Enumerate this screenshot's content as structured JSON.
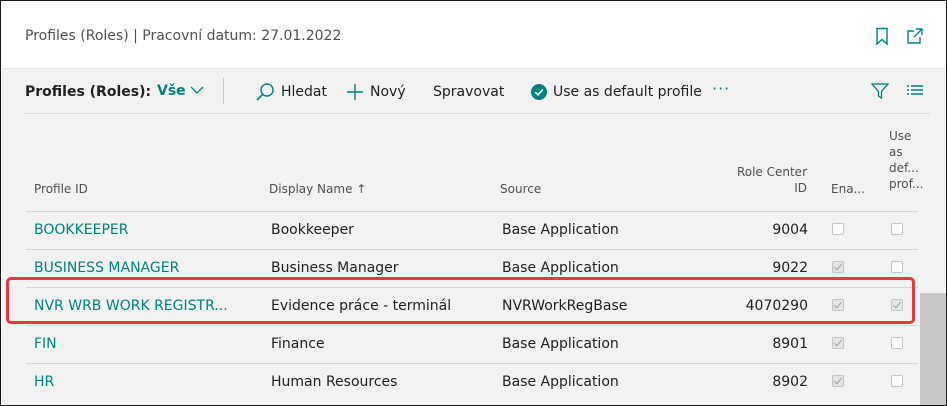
{
  "window": {
    "title": "Profiles (Roles) | Pracovní datum: 27.01.2022"
  },
  "actionbar": {
    "list_title": "Profiles (Roles):",
    "filter_label": "Vše",
    "search_label": "Hledat",
    "new_label": "Nový",
    "manage_label": "Spravovat",
    "default_profile_label": "Use as default profile",
    "more_label": "···"
  },
  "table": {
    "columns": {
      "profile_id": "Profile ID",
      "display_name": "Display Name",
      "source": "Source",
      "role_center_line1": "Role Center",
      "role_center_line2": "ID",
      "enabled": "Ena...",
      "default_line1": "Use",
      "default_line2": "as",
      "default_line3": "def...",
      "default_line4": "prof..."
    },
    "sort_indicator": "↑",
    "rows": [
      {
        "profile_id": "BOOKKEEPER",
        "display_name": "Bookkeeper",
        "source": "Base Application",
        "role_center_id": "9004",
        "enabled": false,
        "default": false
      },
      {
        "profile_id": "BUSINESS MANAGER",
        "display_name": "Business Manager",
        "source": "Base Application",
        "role_center_id": "9022",
        "enabled": true,
        "default": false
      },
      {
        "profile_id": "NVR WRB WORK REGISTR...",
        "display_name": "Evidence práce - terminál",
        "source": "NVRWorkRegBase",
        "role_center_id": "4070290",
        "enabled": true,
        "default": true
      },
      {
        "profile_id": "FIN",
        "display_name": "Finance",
        "source": "Base Application",
        "role_center_id": "8901",
        "enabled": true,
        "default": false
      },
      {
        "profile_id": "HR",
        "display_name": "Human Resources",
        "source": "Base Application",
        "role_center_id": "8902",
        "enabled": true,
        "default": false
      }
    ]
  },
  "colors": {
    "accent": "#00827f",
    "highlight": "#e0393e",
    "content_bg": "#f2f2f2"
  }
}
